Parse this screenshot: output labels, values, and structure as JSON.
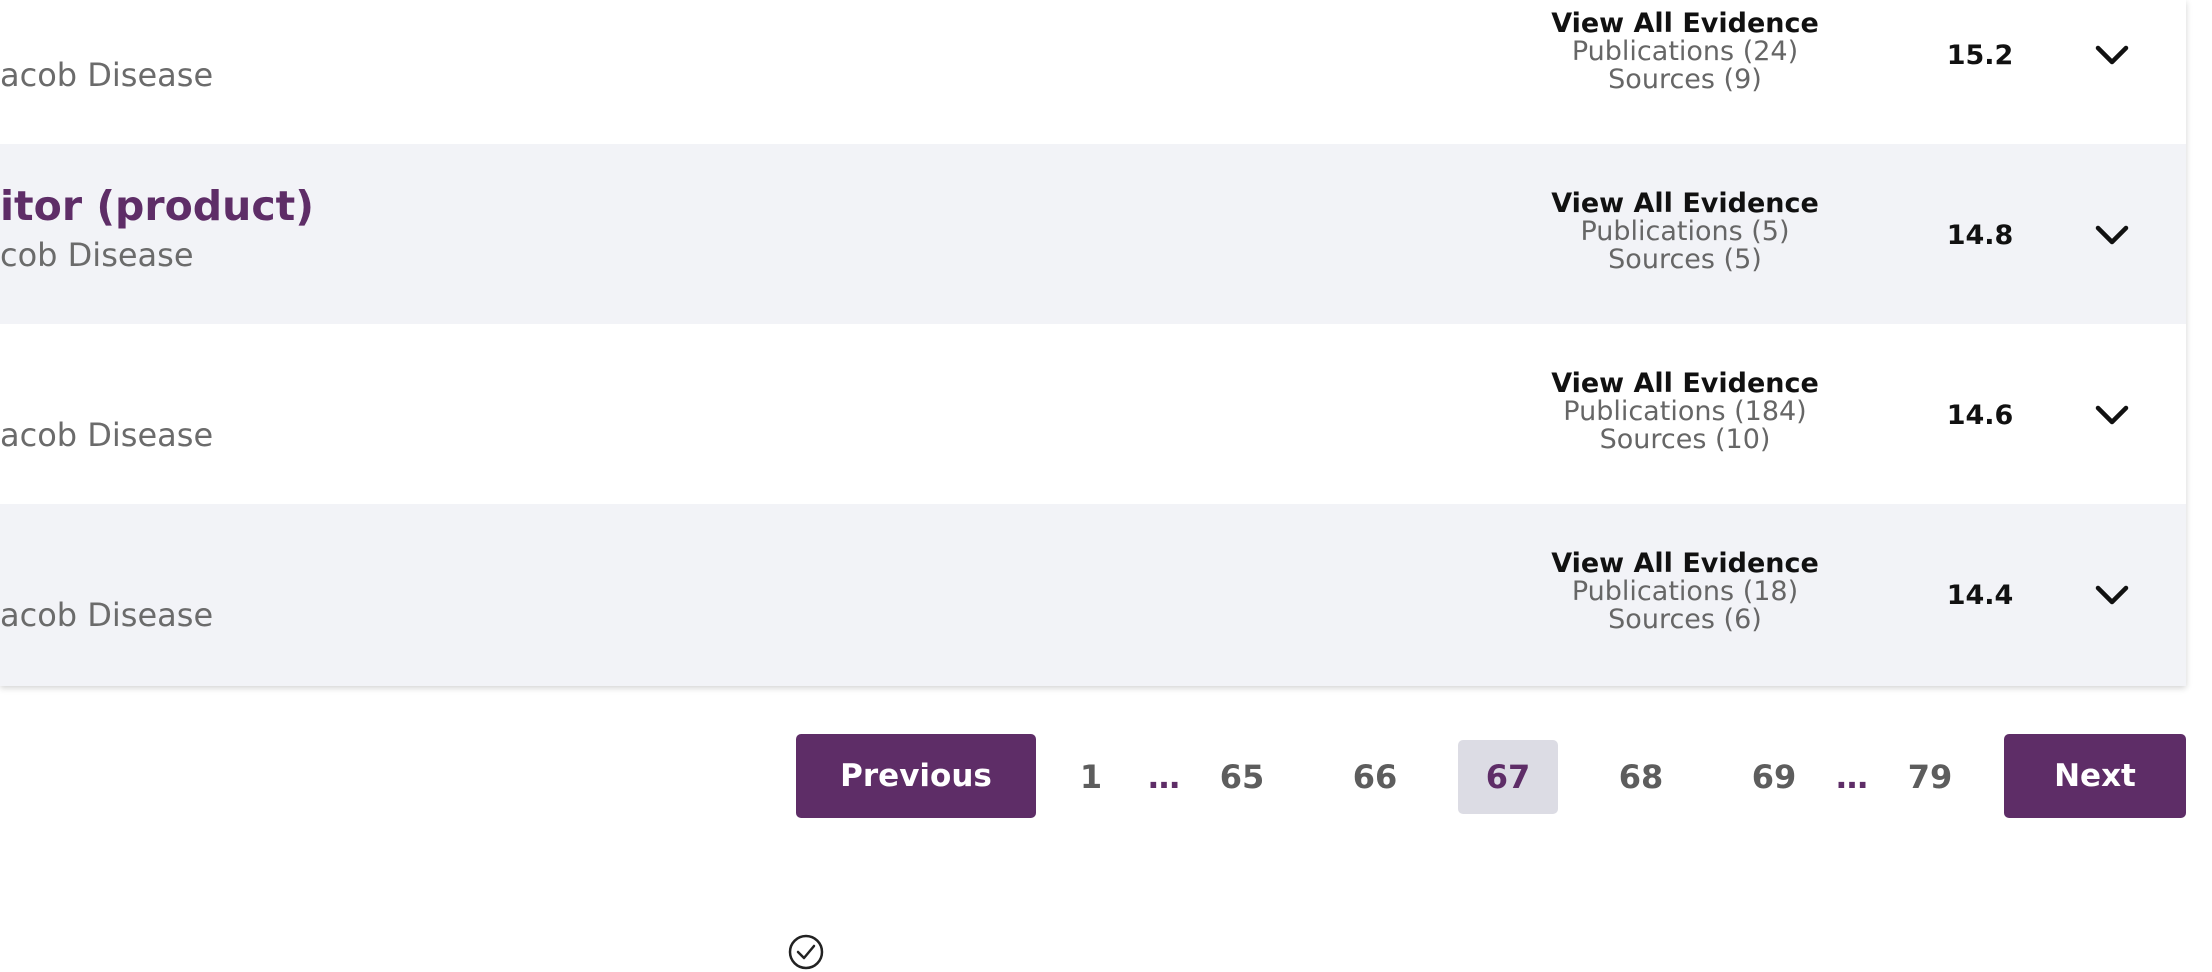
{
  "rows": [
    {
      "title": "",
      "disease": "acob Disease",
      "evidence_link": "View All Evidence",
      "publications": "Publications (24)",
      "sources": "Sources (9)",
      "score": "15.2"
    },
    {
      "title": "itor (product)",
      "disease": "cob Disease",
      "evidence_link": "View All Evidence",
      "publications": "Publications (5)",
      "sources": "Sources (5)",
      "score": "14.8"
    },
    {
      "title": "",
      "disease": "acob Disease",
      "evidence_link": "View All Evidence",
      "publications": "Publications (184)",
      "sources": "Sources (10)",
      "score": "14.6"
    },
    {
      "title": "",
      "disease": "acob Disease",
      "evidence_link": "View All Evidence",
      "publications": "Publications (18)",
      "sources": "Sources (6)",
      "score": "14.4"
    }
  ],
  "pagination": {
    "previous_label": "Previous",
    "next_label": "Next",
    "pages": [
      "1",
      "…",
      "65",
      "66",
      "67",
      "68",
      "69",
      "…",
      "79"
    ],
    "current": "67"
  },
  "colors": {
    "accent": "#5e2d67",
    "row_alt": "#f2f3f7",
    "current_page_bg": "#dcdce4"
  },
  "icons": {
    "row_expand": "chevron-down-icon",
    "bottom": "check-circle-icon"
  }
}
